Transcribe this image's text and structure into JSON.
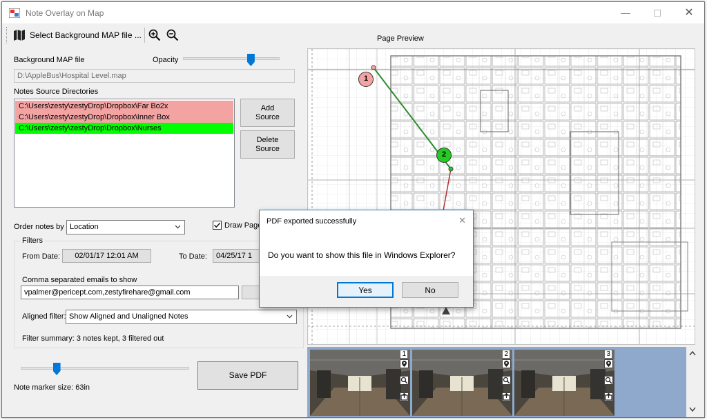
{
  "window": {
    "title": "Note Overlay on Map",
    "minimize_icon": "minimize-icon",
    "maximize_icon": "maximize-icon",
    "close_icon": "close-icon"
  },
  "toolbar": {
    "select_map_label": "Select Background MAP file ...",
    "map_icon": "map-icon",
    "zoom_in_icon": "zoom-in-icon",
    "zoom_out_icon": "zoom-out-icon"
  },
  "left_panel": {
    "background_map_label": "Background MAP file",
    "opacity_label": "Opacity",
    "opacity_level": 0.72,
    "map_path": "D:\\AppleBus\\Hospital Level.map",
    "notes_sources_label": "Notes Source Directories",
    "sources": [
      {
        "path": "C:\\Users\\zesty\\zestyDrop\\Dropbox\\Far Bo2x",
        "color": "#f4a3a3"
      },
      {
        "path": "C:\\Users\\zesty\\zestyDrop\\Dropbox\\Inner Box",
        "color": "#f4a3a3"
      },
      {
        "path": "C:\\Users\\zesty\\zestyDrop\\Dropbox\\Nurses",
        "color": "#00ff00"
      }
    ],
    "add_source_label": "Add\nSource",
    "delete_source_label": "Delete\nSource",
    "order_by_label": "Order notes by",
    "order_by_value": "Location",
    "draw_page_label": "Draw Page",
    "draw_page_checked": true,
    "filters_label": "Filters",
    "from_date_label": "From Date:",
    "from_date_value": "02/01/17 12:01 AM",
    "to_date_label": "To Date:",
    "to_date_value": "04/25/17 1",
    "emails_label": "Comma separated emails to show",
    "emails_value": "vpalmer@pericept.com,zestyfirehare@gmail.com",
    "aligned_filter_label": "Aligned filter:",
    "aligned_filter_value": "Show Aligned and Unaligned Notes",
    "filter_summary": "Filter summary: 3 notes kept, 3 filtered out",
    "marker_size_label": "Note marker size: 63in",
    "marker_size_level": 0.2,
    "save_pdf_label": "Save PDF"
  },
  "preview": {
    "title": "Page Preview",
    "markers": [
      "1",
      "2"
    ]
  },
  "thumbnails": [
    {
      "number": "1"
    },
    {
      "number": "2"
    },
    {
      "number": "3"
    }
  ],
  "dialog": {
    "title": "PDF exported successfully",
    "message": "Do you want to show this file in Windows Explorer?",
    "yes_label": "Yes",
    "no_label": "No",
    "close_icon": "close-icon"
  },
  "colors": {
    "accent": "#0078d7",
    "route_line": "#2e8b2e",
    "marker_1": "#f4a3a3",
    "marker_2": "#22cc22"
  }
}
